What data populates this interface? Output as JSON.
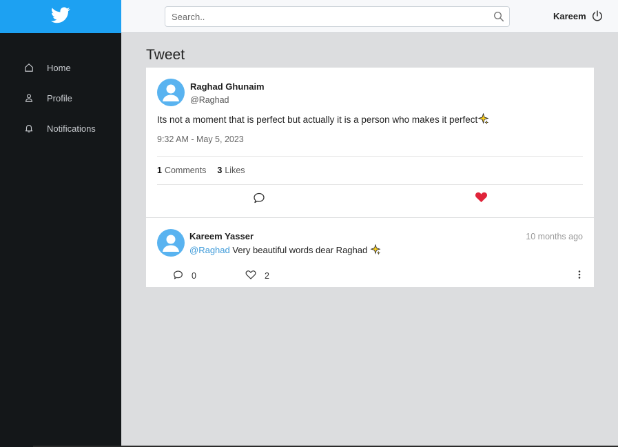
{
  "sidebar": {
    "items": [
      {
        "label": "Home",
        "icon": "home-icon"
      },
      {
        "label": "Profile",
        "icon": "user-icon"
      },
      {
        "label": "Notifications",
        "icon": "bell-icon"
      }
    ]
  },
  "topbar": {
    "search_placeholder": "Search..",
    "user_name": "Kareem"
  },
  "page": {
    "title": "Tweet"
  },
  "tweet": {
    "author_name": "Raghad Ghunaim",
    "handle": "@Raghad",
    "text": "Its not a moment that is perfect but actually it is a person who makes it perfect",
    "time": "9:32 AM - May 5, 2023",
    "comments_count": "1",
    "comments_label": "Comments",
    "likes_count": "3",
    "likes_label": "Likes",
    "liked": true
  },
  "comments": [
    {
      "author_name": "Kareem Yasser",
      "mention": "@Raghad",
      "text": "Very beautiful words dear Raghad",
      "relative_time": "10 months ago",
      "reply_count": "0",
      "like_count": "2"
    }
  ],
  "colors": {
    "brand": "#1da1f2",
    "sidebar_bg": "#141719",
    "avatar": "#59b3f0",
    "heart": "#e0243a",
    "mention": "#3d9ad9"
  }
}
